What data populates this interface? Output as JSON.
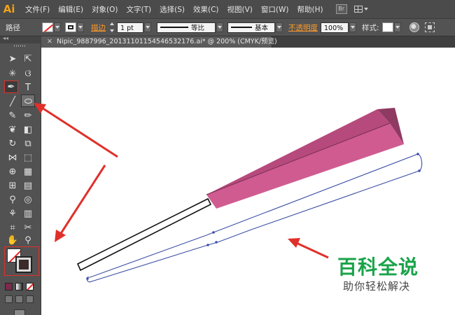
{
  "app": {
    "logo_text": "Ai",
    "accent_color": "#f0a21a"
  },
  "menubar": {
    "items": [
      "文件(F)",
      "编辑(E)",
      "对象(O)",
      "文字(T)",
      "选择(S)",
      "效果(C)",
      "视图(V)",
      "窗口(W)",
      "帮助(H)"
    ],
    "bridge_label": "Br"
  },
  "controlbar": {
    "path_label": "路径",
    "stroke_label": "描边",
    "stroke_weight": "1 pt",
    "profile_label": "等比",
    "brush_label": "基本",
    "opacity_label": "不透明度",
    "opacity_value": "100%",
    "style_label": "样式:"
  },
  "document_tab": {
    "title": "Nipic_9887996_20131101154546532176.ai* @ 200% (CMYK/预览)"
  },
  "toolbar": {
    "icons": [
      "selection-tool-icon",
      "direct-selection-tool-icon",
      "magic-wand-tool-icon",
      "lasso-tool-icon",
      "pen-tool-icon",
      "type-tool-icon",
      "line-segment-tool-icon",
      "ellipse-tool-icon",
      "paintbrush-tool-icon",
      "pencil-tool-icon",
      "blob-brush-tool-icon",
      "eraser-tool-icon",
      "rotate-tool-icon",
      "scale-tool-icon",
      "width-tool-icon",
      "free-transform-tool-icon",
      "shape-builder-tool-icon",
      "perspective-grid-tool-icon",
      "mesh-tool-icon",
      "gradient-tool-icon",
      "eyedropper-tool-icon",
      "blend-tool-icon",
      "symbol-sprayer-tool-icon",
      "column-graph-tool-icon",
      "artboard-tool-icon",
      "slice-tool-icon",
      "hand-tool-icon",
      "zoom-tool-icon"
    ],
    "selected_tool": "pen-tool-icon",
    "fill_color": "none",
    "stroke_color": "#3a2a2a",
    "swatch_colors": [
      "#7d2a4c",
      "gradient",
      "none"
    ]
  },
  "canvas": {
    "fan_colors": {
      "front": "#cf5b91",
      "top": "#b64a7c",
      "dark": "#8e3a62",
      "edge": "#7a2e52"
    },
    "path_color": "#3d4fa6",
    "annotation_color": "#e0302a"
  },
  "watermark": {
    "title": "百科全说",
    "subtitle": "助你轻松解决"
  }
}
